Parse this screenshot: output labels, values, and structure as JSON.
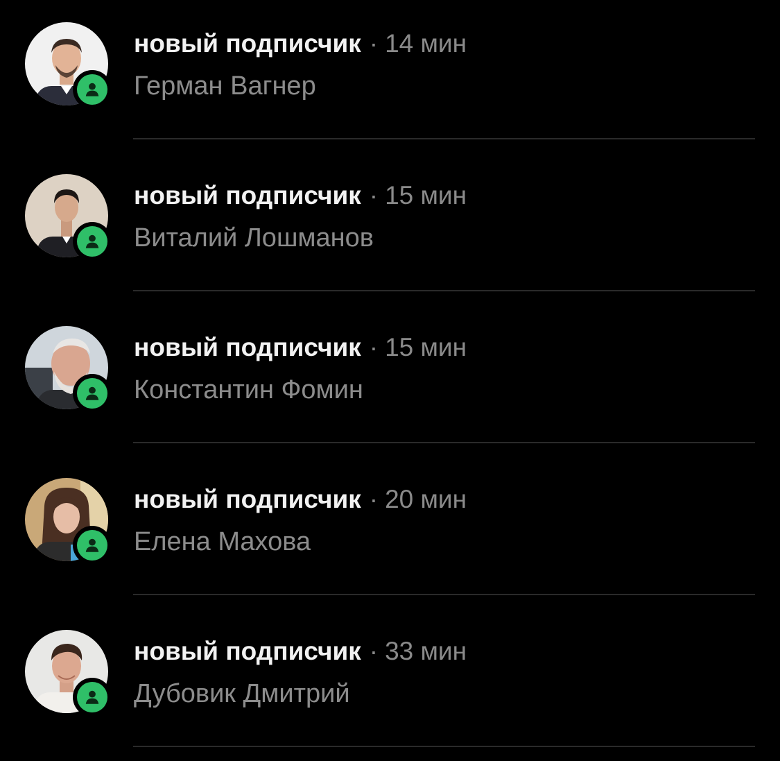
{
  "notifications": [
    {
      "event": "новый подписчик",
      "separator": "·",
      "time": "14 мин",
      "name": "Герман Вагнер",
      "avatar_icon": "person-photo-icon",
      "badge_icon": "follower-person-icon"
    },
    {
      "event": "новый подписчик",
      "separator": "·",
      "time": "15 мин",
      "name": "Виталий Лошманов",
      "avatar_icon": "person-photo-icon",
      "badge_icon": "follower-person-icon"
    },
    {
      "event": "новый подписчик",
      "separator": "·",
      "time": "15 мин",
      "name": "Константин Фомин",
      "avatar_icon": "person-photo-icon",
      "badge_icon": "follower-person-icon"
    },
    {
      "event": "новый подписчик",
      "separator": "·",
      "time": "20 мин",
      "name": "Елена Махова",
      "avatar_icon": "person-photo-icon",
      "badge_icon": "follower-person-icon"
    },
    {
      "event": "новый подписчик",
      "separator": "·",
      "time": "33 мин",
      "name": "Дубовик Дмитрий",
      "avatar_icon": "person-photo-icon",
      "badge_icon": "follower-person-icon"
    }
  ],
  "colors": {
    "background": "#000000",
    "badge": "#2fbf68",
    "title": "#f2f2f2",
    "secondary": "#8a8a8a",
    "divider": "#2a2a2a"
  }
}
